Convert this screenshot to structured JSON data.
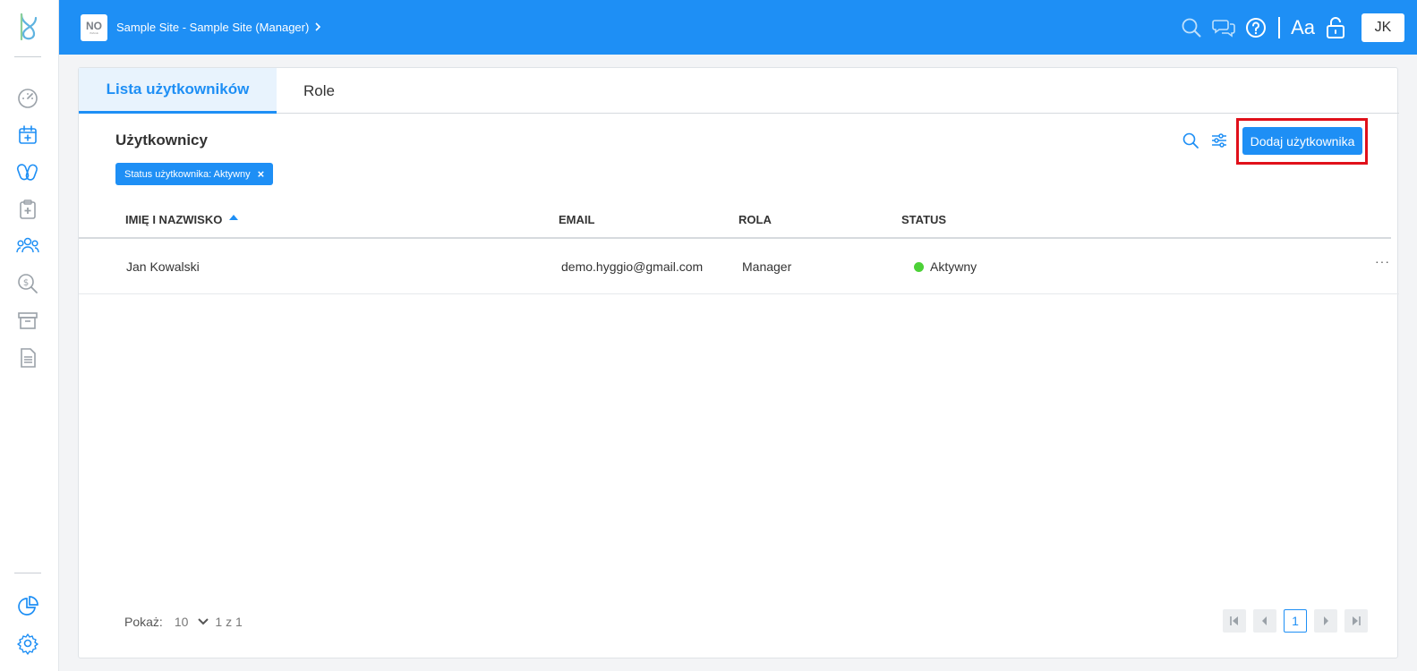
{
  "header": {
    "site_badge": "NO",
    "site_badge_sub": "IMAGE",
    "site_title": "Sample Site - Sample Site (Manager)",
    "font_toggle_label": "Aa",
    "avatar_initials": "JK"
  },
  "tabs": [
    {
      "label": "Lista użytkowników",
      "active": true
    },
    {
      "label": "Role",
      "active": false
    }
  ],
  "section": {
    "title": "Użytkownicy",
    "filter_chip": "Status użytkownika: Aktywny",
    "filter_remove": "×",
    "add_button": "Dodaj użytkownika"
  },
  "table": {
    "columns": [
      "IMIĘ I NAZWISKO",
      "EMAIL",
      "ROLA",
      "STATUS"
    ],
    "sort_column": "IMIĘ I NAZWISKO",
    "rows": [
      {
        "name": "Jan Kowalski",
        "email": "demo.hyggio@gmail.com",
        "role": "Manager",
        "status": "Aktywny",
        "menu": "···"
      }
    ]
  },
  "footer": {
    "show_label": "Pokaż:",
    "page_size": "10",
    "range": "1 z 1",
    "current_page": "1"
  },
  "colors": {
    "brand": "#1e8ff5",
    "status_active": "#4cd137",
    "highlight_frame": "#e0101a"
  },
  "icons": {
    "sidebar": [
      "logo-icon",
      "dashboard-icon",
      "calendar-add-icon",
      "medication-icon",
      "clipboard-add-icon",
      "users-icon",
      "search-dollar-icon",
      "archive-icon",
      "document-icon",
      "pie-chart-icon",
      "gear-icon"
    ],
    "header": [
      "search-icon",
      "chat-icon",
      "help-icon",
      "lock-icon"
    ]
  }
}
